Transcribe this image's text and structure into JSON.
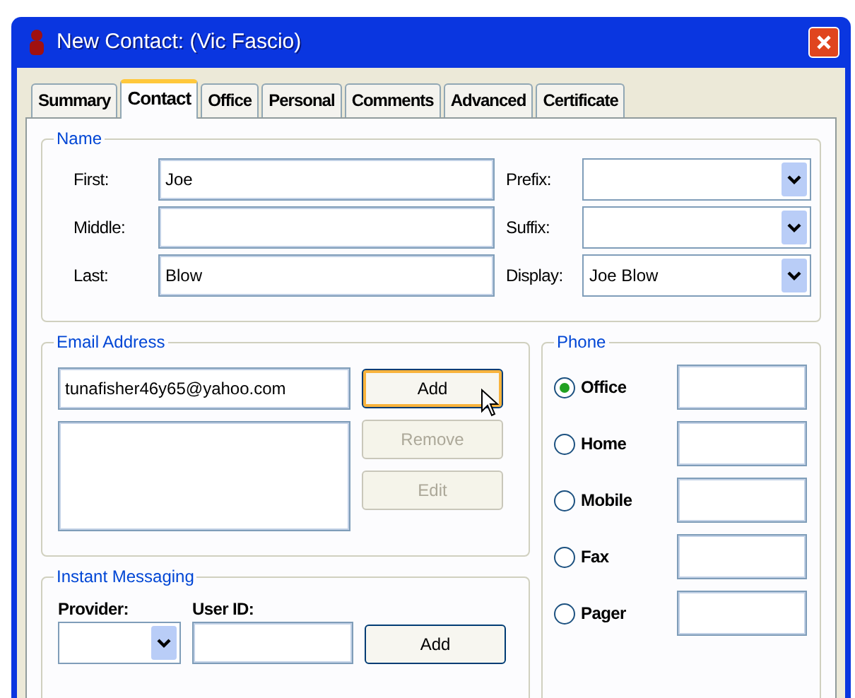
{
  "window": {
    "title": "New Contact:  (Vic Fascio)"
  },
  "tabs": [
    {
      "label": "Summary",
      "selected": false
    },
    {
      "label": "Contact",
      "selected": true
    },
    {
      "label": "Office",
      "selected": false
    },
    {
      "label": "Personal",
      "selected": false
    },
    {
      "label": "Comments",
      "selected": false
    },
    {
      "label": "Advanced",
      "selected": false
    },
    {
      "label": "Certificate",
      "selected": false
    }
  ],
  "name_group": {
    "title": "Name",
    "fields": [
      {
        "label": "First:",
        "value": "Joe"
      },
      {
        "label": "Middle:"
      },
      {
        "label": "Last:",
        "value": "Blow"
      }
    ],
    "combos": [
      {
        "label": "Prefix:"
      },
      {
        "label": "Suffix:"
      },
      {
        "label": "Display:",
        "value": "Joe Blow"
      }
    ]
  },
  "email_group": {
    "title": "Email Address",
    "input": "tunafisher46y65@yahoo.com",
    "buttons": [
      {
        "label": "Add",
        "disabled": false,
        "focused": true
      },
      {
        "label": "Remove",
        "disabled": true,
        "focused": false
      },
      {
        "label": "Edit",
        "disabled": true,
        "focused": false
      }
    ]
  },
  "phone_group": {
    "title": "Phone",
    "options": [
      {
        "label": "Office",
        "selected": true
      },
      {
        "label": "Home",
        "selected": false
      },
      {
        "label": "Mobile",
        "selected": false
      },
      {
        "label": "Fax",
        "selected": false
      },
      {
        "label": "Pager",
        "selected": false
      }
    ]
  },
  "im_group": {
    "title": "Instant Messaging",
    "provider_label": "Provider:",
    "userid_label": "User ID:",
    "button": {
      "label": "Add",
      "disabled": false
    }
  }
}
